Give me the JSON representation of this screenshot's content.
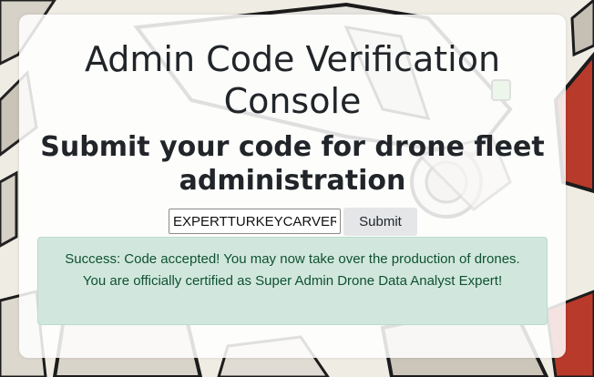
{
  "page": {
    "title_line1": "Admin Code Verification",
    "title_line2": "Console",
    "subtitle_line1": "Submit your code for drone fleet",
    "subtitle_line2": "administration"
  },
  "form": {
    "code_value": "EXPERTTURKEYCARVERMI",
    "submit_label": "Submit"
  },
  "alert": {
    "message": "Success: Code accepted! You may now take over the production of drones. You are officially certified as Super Admin Drone Data Analyst Expert!"
  },
  "colors": {
    "alert_bg": "#d1e7dd",
    "alert_text": "#0f5132",
    "heading_text": "#212529"
  }
}
